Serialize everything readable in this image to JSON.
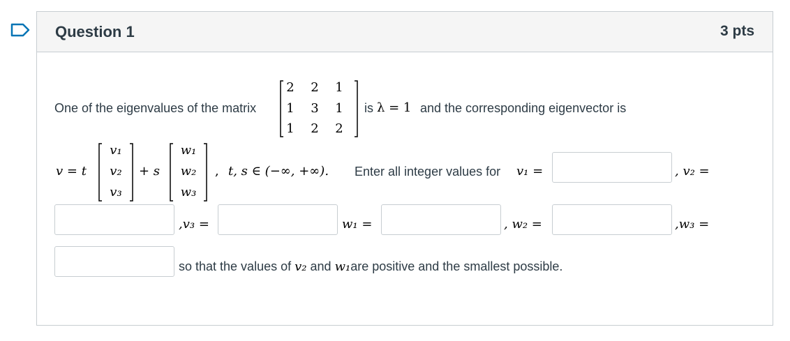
{
  "question": {
    "title": "Question 1",
    "points": "3 pts"
  },
  "body": {
    "intro": "One of the eigenvalues of the matrix",
    "matrix": [
      [
        "2",
        "2",
        "1"
      ],
      [
        "1",
        "3",
        "1"
      ],
      [
        "1",
        "2",
        "2"
      ]
    ],
    "is_text": "is",
    "lambda": "λ = 1",
    "after_lambda": "and the corresponding eigenvector is",
    "v_eq": "v = t",
    "vec_v": [
      "v₁",
      "v₂",
      "v₃"
    ],
    "plus_s": "+ s",
    "vec_w": [
      "w₁",
      "w₂",
      "w₃"
    ],
    "comma": ",",
    "domain": "t, s ∈ (−∞, +∞).",
    "enter_text": "Enter all integer values for",
    "lbl_v1": "v₁ =",
    "lbl_v2": ", v₂ =",
    "lbl_v3": ",v₃ =",
    "lbl_w1": "w₁ =",
    "lbl_w2": ", w₂ =",
    "lbl_w3": ",w₃ =",
    "closing": "so that the values of",
    "closing_v2": "v₂",
    "closing_and": "and",
    "closing_w1": "w₁",
    "closing_end": "are positive and the smallest possible."
  },
  "answers": {
    "v1": "",
    "v2": "",
    "v3": "",
    "w1": "",
    "w2": "",
    "w3": ""
  }
}
